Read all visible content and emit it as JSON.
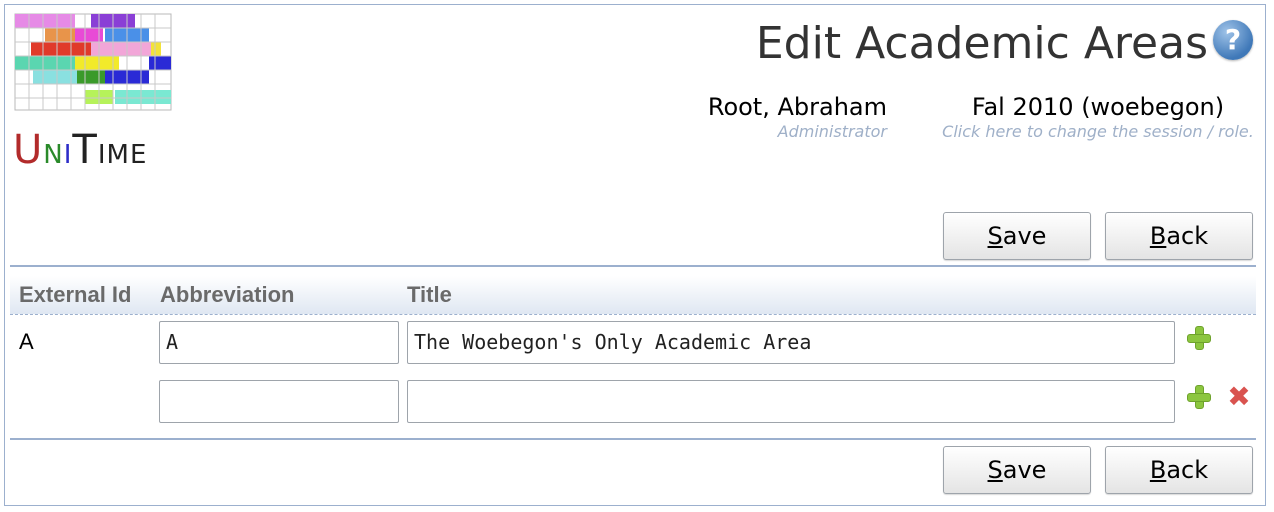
{
  "logo": {
    "text_u": "U",
    "text_n": "N",
    "text_i": "I",
    "text_t": "T",
    "text_ime": "IME"
  },
  "header": {
    "title": "Edit Academic Areas",
    "help_icon": "?",
    "user_name": "Root, Abraham",
    "user_role": "Administrator",
    "session_name": "Fal 2010 (woebegon)",
    "session_hint": "Click here to change the session / role."
  },
  "buttons": {
    "save_first": "S",
    "save_rest": "ave",
    "back_first": "B",
    "back_rest": "ack"
  },
  "table": {
    "columns": [
      "External Id",
      "Abbreviation",
      "Title"
    ],
    "rows": [
      {
        "external_id": "A",
        "abbreviation": "A",
        "title": "The Woebegon's Only Academic Area"
      },
      {
        "external_id": "",
        "abbreviation": "",
        "title": ""
      }
    ]
  },
  "colors": {
    "accent_border": "#9cb0ce",
    "add_icon": "#8cc63f",
    "delete_icon": "#d9534f"
  }
}
